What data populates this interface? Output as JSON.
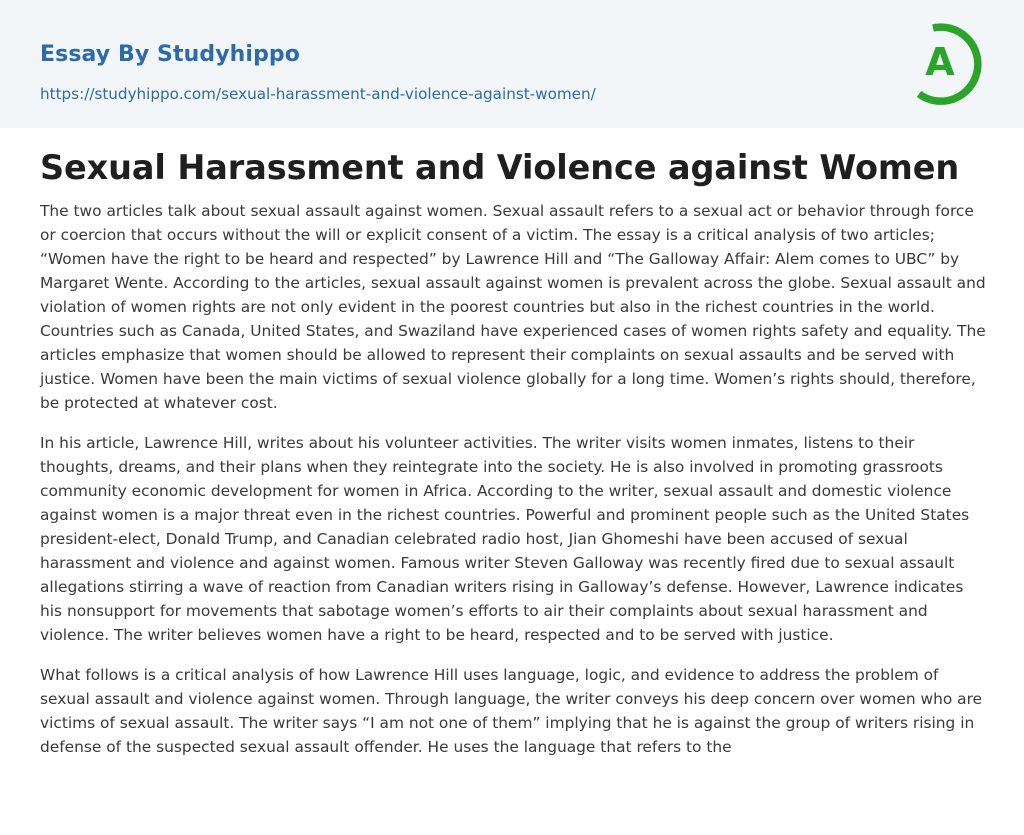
{
  "header": {
    "brand": "Essay By Studyhippo",
    "url": "https://studyhippo.com/sexual-harassment-and-violence-against-women/",
    "logo_letter": "A",
    "logo_color": "#2aa52a"
  },
  "article": {
    "title": "Sexual Harassment and Violence against Women",
    "paragraphs": [
      "The two articles talk about sexual assault against women. Sexual assault refers to a sexual act or behavior through force or coercion that occurs without the will or explicit consent of a victim. The essay is a critical analysis of two articles; “Women have the right to be heard and respected” by Lawrence Hill and “The Galloway Affair: Alem comes to UBC” by Margaret Wente. According to the articles, sexual assault against women is prevalent across the globe. Sexual assault and violation of women rights are not only evident in the poorest countries but also in the richest countries in the world. Countries such as Canada, United States, and Swaziland have experienced cases of women rights safety and equality. The articles emphasize that women should be allowed to represent their complaints on sexual assaults and be served with justice. Women have been the main victims of sexual violence globally for a long time. Women’s rights should, therefore, be protected at whatever cost.",
      "In his article, Lawrence Hill, writes about his volunteer activities. The writer visits women inmates, listens to their thoughts, dreams, and their plans when they reintegrate into the society. He is also involved in promoting grassroots community economic development for women in Africa. According to the writer, sexual assault and domestic violence against women is a major threat even in the richest countries. Powerful and prominent people such as the United States president-elect, Donald Trump, and Canadian celebrated radio host, Jian Ghomeshi have been accused of sexual harassment and violence and against women. Famous writer Steven Galloway was recently fired due to sexual assault allegations stirring a wave of reaction from Canadian writers rising in Galloway’s defense. However, Lawrence indicates his nonsupport for movements that sabotage women’s efforts to air their complaints about sexual harassment and violence. The writer believes women have a right to be heard, respected and to be served with justice.",
      "What follows is a critical analysis of how Lawrence Hill uses language, logic, and evidence to address the problem of sexual assault and violence against women. Through language, the writer conveys his deep concern over women who are victims of sexual assault. The writer says “I am not one of them” implying that he is against the group of writers rising in defense of the suspected sexual assault offender. He uses the language that refers to the"
    ]
  }
}
